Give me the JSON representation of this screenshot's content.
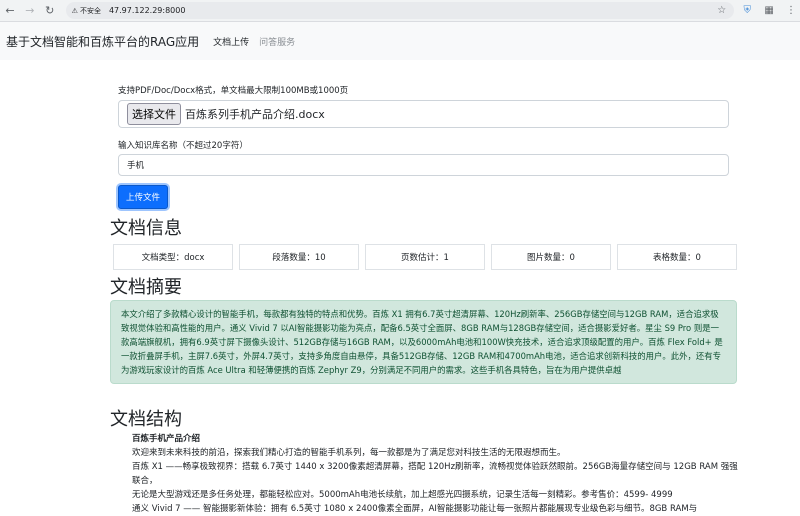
{
  "browser": {
    "security_label": "不安全",
    "url": "47.97.122.29:8000"
  },
  "navbar": {
    "brand": "基于文档智能和百炼平台的RAG应用",
    "links": [
      {
        "label": "文档上传"
      },
      {
        "label": "问答服务"
      }
    ]
  },
  "upload": {
    "hint": "支持PDF/Doc/Docx格式，单文档最大限制100MB或1000页",
    "choose_file_label": "选择文件",
    "file_name": "百炼系列手机产品介绍.docx",
    "kb_label": "输入知识库名称（不超过20字符）",
    "kb_value": "手机",
    "upload_button": "上传文件"
  },
  "doc_info": {
    "heading": "文档信息",
    "items": [
      {
        "text": "文档类型：docx"
      },
      {
        "text": "段落数量：10"
      },
      {
        "text": "页数估计：1"
      },
      {
        "text": "图片数量：0"
      },
      {
        "text": "表格数量：0"
      }
    ]
  },
  "summary": {
    "heading": "文档摘要",
    "text": "本文介绍了多款精心设计的智能手机，每款都有独特的特点和优势。百炼 X1 拥有6.7英寸超清屏幕、120Hz刷新率、256GB存储空间与12GB RAM，适合追求极致视觉体验和高性能的用户。通义 Vivid 7 以AI智能摄影功能为亮点，配备6.5英寸全面屏、8GB RAM与128GB存储空间，适合摄影爱好者。星尘 S9 Pro 则是一款高端旗舰机，拥有6.9英寸屏下摄像头设计、512GB存储与16GB RAM，以及6000mAh电池和100W快充技术，适合追求顶级配置的用户。百炼 Flex Fold+ 是一款折叠屏手机，主屏7.6英寸，外屏4.7英寸，支持多角度自由悬停，具备512GB存储、12GB RAM和4700mAh电池，适合追求创新科技的用户。此外，还有专为游戏玩家设计的百炼 Ace Ultra 和轻薄便携的百炼 Zephyr Z9，分别满足不同用户的需求。这些手机各具特色，旨在为用户提供卓越"
  },
  "structure": {
    "heading": "文档结构",
    "title": "百炼手机产品介绍",
    "lines": [
      "欢迎来到未来科技的前沿，探索我们精心打造的智能手机系列，每一款都是为了满足您对科技生活的无限遐想而生。",
      "百炼 X1 ——畅享极致视界：搭载 6.7英寸 1440 x 3200像素超清屏幕，搭配 120Hz刷新率，流畅视觉体验跃然眼前。256GB海量存储空间与 12GB RAM 强强联合，",
      "无论是大型游戏还是多任务处理，都能轻松应对。5000mAh电池长续航，加上超感光四摄系统，记录生活每一刻精彩。参考售价：4599- 4999",
      "通义 Vivid 7 —— 智能摄影新体验：拥有 6.5英寸 1080 x 2400像素全面屏，AI智能摄影功能让每一张照片都能展现专业级色彩与细节。8GB RAM与"
    ]
  }
}
